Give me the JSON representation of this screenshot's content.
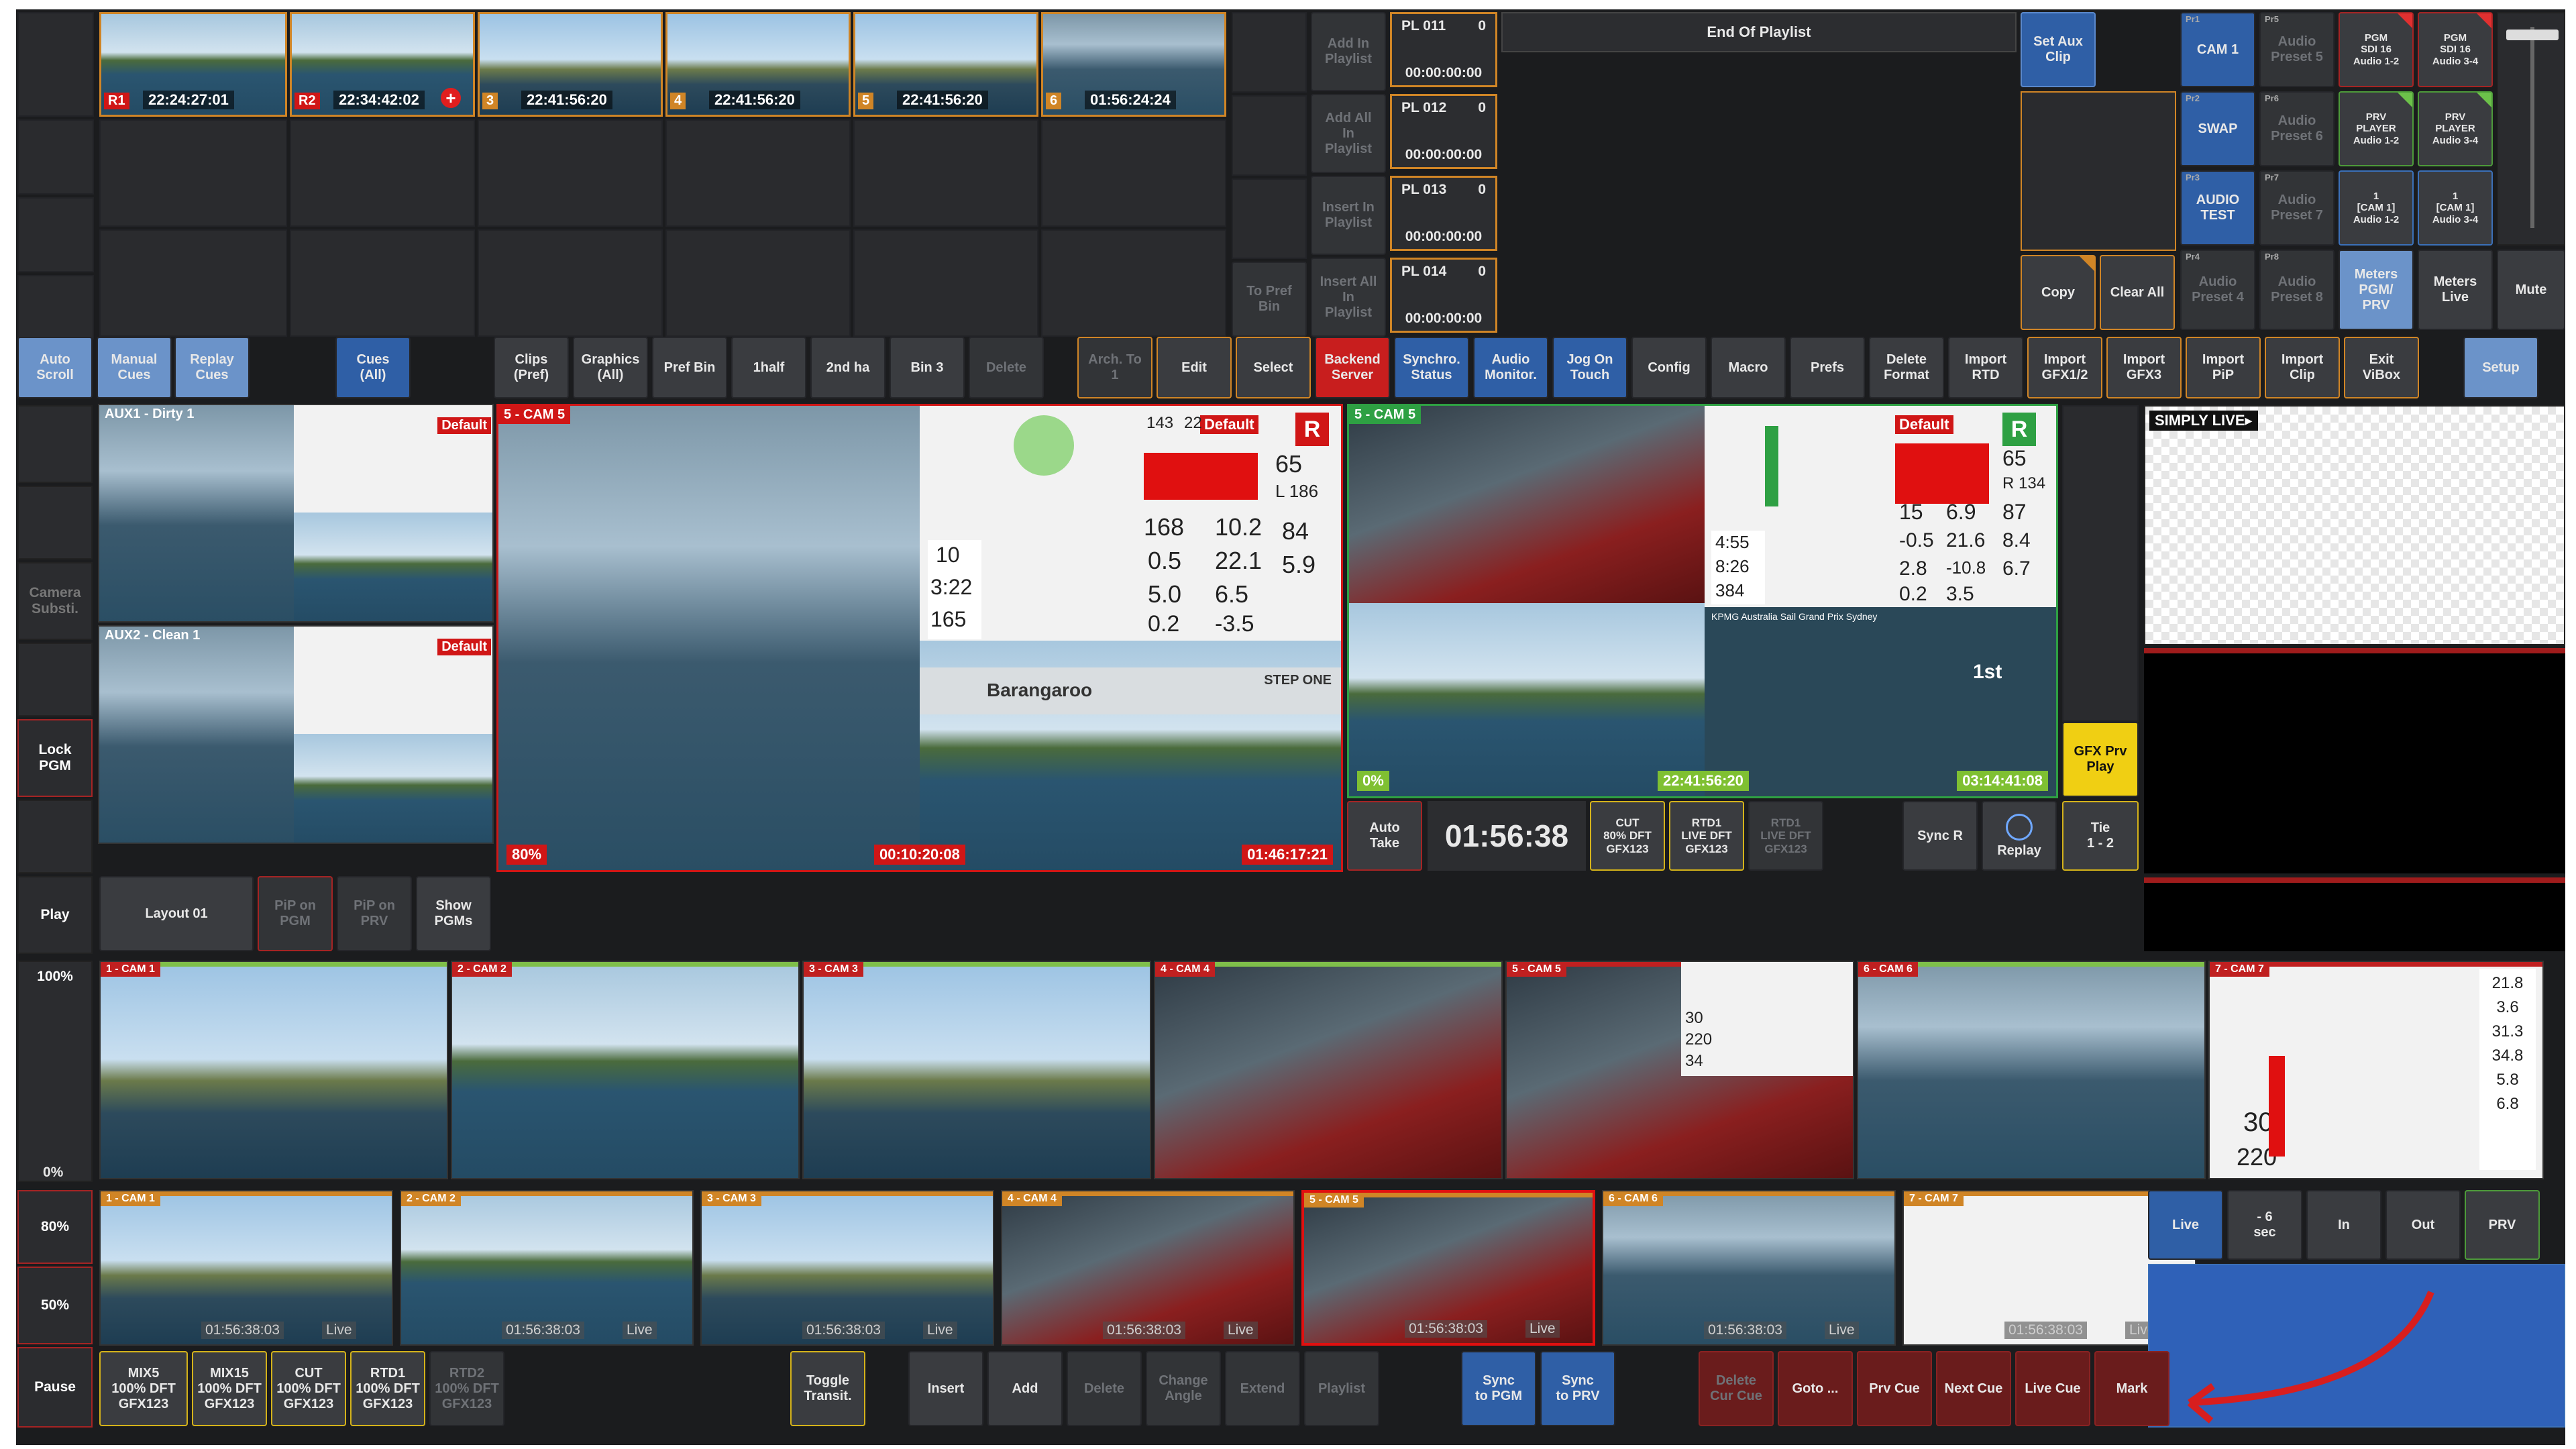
{
  "top_thumbs": [
    {
      "badge": "R1",
      "tc": "22:24:27:01"
    },
    {
      "badge": "R2",
      "tc": "22:34:42:02"
    },
    {
      "badge": "3",
      "tc": "22:41:56:20"
    },
    {
      "badge": "4",
      "tc": "22:41:56:20"
    },
    {
      "badge": "5",
      "tc": "22:41:56:20"
    },
    {
      "badge": "6",
      "tc": "01:56:24:24"
    }
  ],
  "playlist_buttons": [
    "Add In\nPlaylist",
    "Add All\nIn\nPlaylist",
    "Insert In\nPlaylist",
    "Insert All\nIn\nPlaylist"
  ],
  "to_pref_bin": "To Pref\nBin",
  "playlists": [
    {
      "name": "PL 011",
      "count": "0",
      "time": "00:00:00:00"
    },
    {
      "name": "PL 012",
      "count": "0",
      "time": "00:00:00:00"
    },
    {
      "name": "PL 013",
      "count": "0",
      "time": "00:00:00:00"
    },
    {
      "name": "PL 014",
      "count": "0",
      "time": "00:00:00:00"
    }
  ],
  "end_of_playlist": "End Of Playlist",
  "set_aux_clip": "Set Aux\nClip",
  "copy": "Copy",
  "clear_all": "Clear All",
  "right_grid": [
    {
      "tag": "Pr1",
      "label": "CAM 1",
      "dim": false
    },
    {
      "tag": "Pr5",
      "label": "Audio\nPreset 5",
      "dim": true
    },
    {
      "tag": "",
      "label": "PGM\nSDI 16\nAudio 1-2",
      "dim": false
    },
    {
      "tag": "",
      "label": "PGM\nSDI 16\nAudio 3-4",
      "dim": false
    },
    {
      "tag": "Pr2",
      "label": "SWAP",
      "dim": false
    },
    {
      "tag": "Pr6",
      "label": "Audio\nPreset 6",
      "dim": true
    },
    {
      "tag": "",
      "label": "PRV\nPLAYER\nAudio 1-2",
      "dim": false
    },
    {
      "tag": "",
      "label": "PRV\nPLAYER\nAudio 3-4",
      "dim": false
    },
    {
      "tag": "Pr3",
      "label": "AUDIO\nTEST",
      "dim": false
    },
    {
      "tag": "Pr7",
      "label": "Audio\nPreset 7",
      "dim": true
    },
    {
      "tag": "",
      "label": "1\n[CAM 1]\nAudio 1-2",
      "dim": false
    },
    {
      "tag": "",
      "label": "1\n[CAM 1]\nAudio 3-4",
      "dim": false
    },
    {
      "tag": "Pr4",
      "label": "Audio\nPreset 4",
      "dim": true
    },
    {
      "tag": "Pr8",
      "label": "Audio\nPreset 8",
      "dim": true
    },
    {
      "tag": "",
      "label": "Meters\nPGM/\nPRV",
      "dim": false
    },
    {
      "tag": "",
      "label": "Meters\nLive",
      "dim": false
    }
  ],
  "mute": "Mute",
  "toolbar": [
    "Auto\nScroll",
    "Manual\nCues",
    "Replay\nCues",
    "Cues\n(All)",
    "Clips\n(Pref)",
    "Graphics\n(All)",
    "Pref Bin",
    "1half",
    "2nd ha",
    "Bin 3",
    "Delete",
    "Arch. To\n1",
    "Edit",
    "Select",
    "Backend\nServer",
    "Synchro.\nStatus",
    "Audio\nMonitor.",
    "Jog On\nTouch",
    "Config",
    "Macro",
    "Prefs",
    "Delete\nFormat",
    "Import\nRTD",
    "Import\nGFX1/2",
    "Import\nGFX3",
    "Import\nPiP",
    "Import\nClip",
    "Exit\nViBox",
    "Setup"
  ],
  "left_tabs": {
    "camera_subst": "Camera\nSubsti.",
    "lock_pgm": "Lock\nPGM",
    "play": "Play",
    "p100": "100%",
    "p0": "0%",
    "p80": "80%",
    "p50": "50%",
    "pause": "Pause"
  },
  "aux": [
    {
      "label": "AUX1 - Dirty 1"
    },
    {
      "label": "AUX2 - Clean 1"
    }
  ],
  "default_tag": "Default",
  "prv": {
    "label": "5 - CAM 5",
    "pct": "80%",
    "tc1": "00:10:20:08",
    "tc2": "01:46:17:21"
  },
  "pgm": {
    "label": "5 - CAM 5",
    "pct": "0%",
    "tc1": "22:41:56:20",
    "tc2": "03:14:41:08"
  },
  "gfx_text": {
    "n1": "143",
    "n2": "22",
    "n3": "65",
    "n4": "L 186",
    "n5": "168",
    "n6": "10.2",
    "n7": "84",
    "n8": "0.5",
    "n9": "22.1",
    "n10": "5.9",
    "n11": "5.0",
    "n12": "6.5",
    "n13": "0.2",
    "n14": "-3.5",
    "n15": "10",
    "n16": "3:22",
    "n17": "165"
  },
  "pgm_gfx": {
    "n1": "65",
    "n2": "R 134",
    "n3": "15",
    "n4": "6.9",
    "n5": "87",
    "n6": "-0.5",
    "n7": "21.6",
    "n8": "8.4",
    "n9": "2.8",
    "n10": "-10.8",
    "n11": "6.7",
    "n12": "0.2",
    "n13": "3.5",
    "n14": "4:55",
    "n15": "8:26",
    "n16": "384"
  },
  "barangaroo": "Barangaroo",
  "step_one": "STEP ONE",
  "leaderboard_title": "KPMG Australia Sail Grand Prix Sydney",
  "first": "1st",
  "layout_row": {
    "layout": "Layout 01",
    "pip_pgm": "PiP on\nPGM",
    "pip_prv": "PiP on\nPRV",
    "show_pgms": "Show\nPGMs"
  },
  "take_row": {
    "auto_take": "Auto\nTake",
    "timer": "01:56:38",
    "cut": "CUT\n80% DFT\nGFX123",
    "rtd1": "RTD1\nLIVE DFT\nGFX123",
    "rtd1b": "RTD1\nLIVE DFT\nGFX123",
    "sync_r": "Sync R",
    "replay": "Replay",
    "tie": "Tie\n1 - 2",
    "gfx_prv": "GFX Prv\nPlay"
  },
  "simply_live": "SIMPLY LIVE▸",
  "cams_top": [
    "1 - CAM 1",
    "2 - CAM 2",
    "3 - CAM 3",
    "4 - CAM 4",
    "5 - CAM 5",
    "6 - CAM 6",
    "7 - CAM 7"
  ],
  "cams_bottom": [
    {
      "label": "1 - CAM 1",
      "tc": "01:56:38:03",
      "live": "Live"
    },
    {
      "label": "2 - CAM 2",
      "tc": "01:56:38:03",
      "live": "Live"
    },
    {
      "label": "3 - CAM 3",
      "tc": "01:56:38:03",
      "live": "Live"
    },
    {
      "label": "4 - CAM 4",
      "tc": "01:56:38:03",
      "live": "Live"
    },
    {
      "label": "5 - CAM 5",
      "tc": "01:56:38:03",
      "live": "Live"
    },
    {
      "label": "6 - CAM 6",
      "tc": "01:56:38:03",
      "live": "Live"
    },
    {
      "label": "7 - CAM 7",
      "tc": "01:56:38:03",
      "live": "Live"
    }
  ],
  "cam7_stats": [
    "21.8",
    "3.6",
    "31.3",
    "34.8",
    "5.8",
    "6.8"
  ],
  "cam7_big": {
    "a": "30",
    "b": "220"
  },
  "cam5_stats": {
    "a": "30",
    "b": "220",
    "c": "34"
  },
  "nav_buttons": [
    "Live",
    "- 6\nsec",
    "In",
    "Out",
    "PRV"
  ],
  "bottom_row": [
    {
      "label": "MIX5\n100% DFT\nGFX123",
      "style": "yellowb"
    },
    {
      "label": "MIX15\n100% DFT\nGFX123",
      "style": "yellowb"
    },
    {
      "label": "CUT\n100% DFT\nGFX123",
      "style": "yellowb"
    },
    {
      "label": "RTD1\n100% DFT\nGFX123",
      "style": "yellowb"
    },
    {
      "label": "RTD2\n100% DFT\nGFX123",
      "style": "dim"
    }
  ],
  "bottom_actions": [
    "Toggle\nTransit.",
    "Insert",
    "Add",
    "Delete",
    "Change\nAngle",
    "Extend",
    "Playlist",
    "Sync\nto PGM",
    "Sync\nto PRV",
    "Delete\nCur Cue",
    "Goto ...",
    "Prv Cue",
    "Next Cue",
    "Live Cue",
    "Mark"
  ],
  "colors": {
    "accent": "#3b70b8",
    "live_red": "#cc1f1f",
    "cue_orange": "#d08526",
    "yellow": "#f4d313",
    "green": "#2ea043"
  }
}
